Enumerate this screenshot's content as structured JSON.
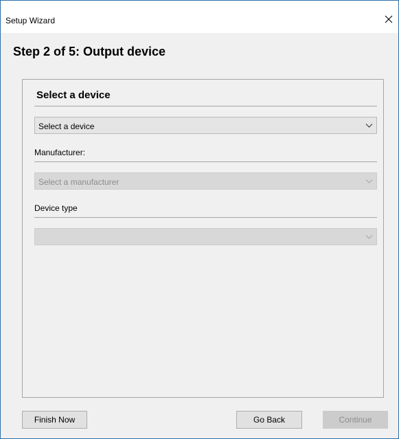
{
  "window": {
    "title": "Setup Wizard"
  },
  "header": {
    "step_title": "Step 2 of 5: Output device"
  },
  "panel": {
    "section_title": "Select a device",
    "device_select": {
      "value": "Select a device",
      "enabled": true
    },
    "manufacturer_label": "Manufacturer:",
    "manufacturer_select": {
      "value": "Select a manufacturer",
      "enabled": false
    },
    "device_type_label": "Device type",
    "device_type_select": {
      "value": "",
      "enabled": false
    }
  },
  "footer": {
    "finish_label": "Finish Now",
    "back_label": "Go Back",
    "continue_label": "Continue",
    "continue_enabled": false
  },
  "icons": {
    "close": "close-icon",
    "dropdown": "chevron-down-icon"
  },
  "colors": {
    "window_border": "#2b6ea8",
    "dialog_background": "#f0f0f0",
    "disabled_text": "#8c8c8c"
  }
}
